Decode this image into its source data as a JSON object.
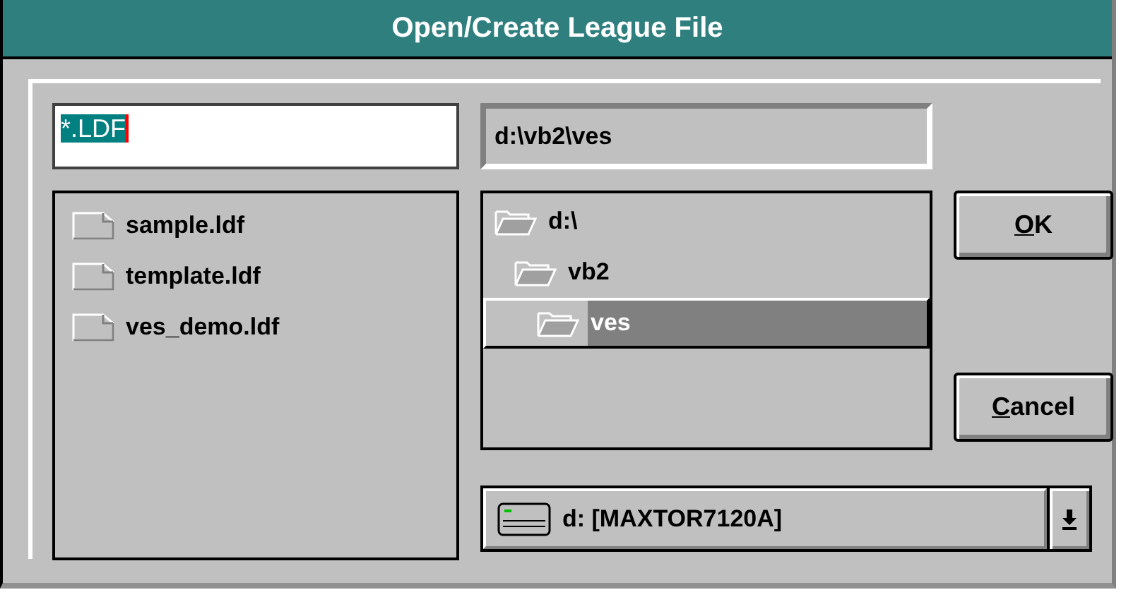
{
  "window": {
    "title": "Open/Create League File"
  },
  "file_name": {
    "value": "*.LDF",
    "selected": true
  },
  "current_directory": "d:\\vb2\\ves",
  "files": [
    {
      "name": "sample.ldf"
    },
    {
      "name": "template.ldf"
    },
    {
      "name": "ves_demo.ldf"
    }
  ],
  "directories": [
    {
      "name": "d:\\",
      "selected": false,
      "children": [
        {
          "name": "vb2",
          "selected": false,
          "children": [
            {
              "name": "ves",
              "selected": true
            }
          ]
        }
      ]
    }
  ],
  "buttons": [
    {
      "label": "OK",
      "access_key_underlined": true
    },
    {
      "label": "Cancel",
      "access_key_underlined": true
    }
  ],
  "drive": {
    "value": "d: [MAXTOR7120A]"
  }
}
